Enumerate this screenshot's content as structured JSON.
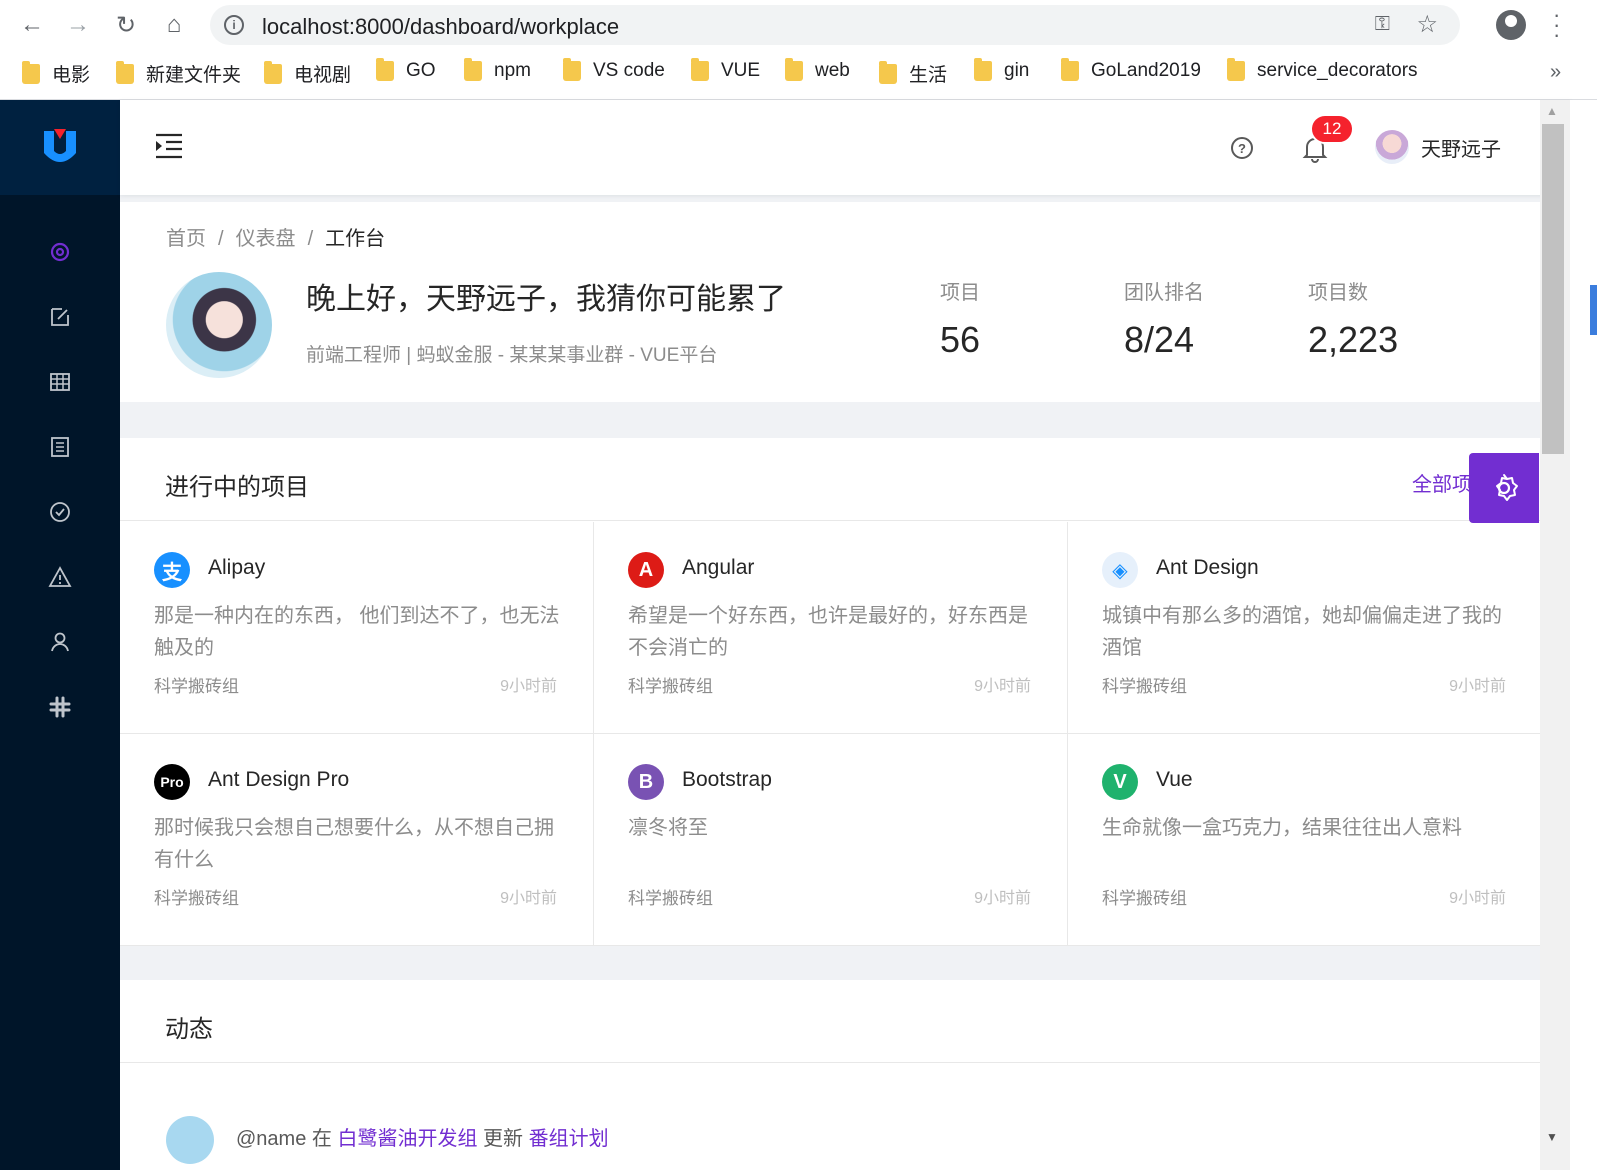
{
  "browser": {
    "url": "localhost:8000/dashboard/workplace",
    "bookmarks": [
      "电影",
      "新建文件夹",
      "电视剧",
      "GO",
      "npm",
      "VS code",
      "VUE",
      "web",
      "生活",
      "gin",
      "GoLand2019",
      "service_decorators"
    ],
    "more": "»"
  },
  "header": {
    "notification_count": "12",
    "username": "天野远子"
  },
  "breadcrumb": [
    "首页",
    "仪表盘",
    "工作台"
  ],
  "breadcrumb_sep": "/",
  "profile": {
    "greeting": "晚上好，天野远子，我猜你可能累了",
    "subtitle": "前端工程师 | 蚂蚁金服 - 某某某事业群 - VUE平台",
    "stats": [
      {
        "label": "项目",
        "value": "56"
      },
      {
        "label": "团队排名",
        "value": "8/24"
      },
      {
        "label": "项目数",
        "value": "2,223"
      }
    ]
  },
  "projects": {
    "title": "进行中的项目",
    "all_link": "全部项",
    "items": [
      {
        "name": "Alipay",
        "desc": "那是一种内在的东西， 他们到达不了，也无法触及的",
        "group": "科学搬砖组",
        "time": "9小时前",
        "icon": "alipay-icon",
        "color": "#1890ff",
        "glyph": "支"
      },
      {
        "name": "Angular",
        "desc": "希望是一个好东西，也许是最好的，好东西是不会消亡的",
        "group": "科学搬砖组",
        "time": "9小时前",
        "icon": "angular-icon",
        "color": "#dd1b16",
        "glyph": "A"
      },
      {
        "name": "Ant Design",
        "desc": "城镇中有那么多的酒馆，她却偏偏走进了我的酒馆",
        "group": "科学搬砖组",
        "time": "9小时前",
        "icon": "ant-design-icon",
        "color": "#e6f0fb",
        "glyph": "◈"
      },
      {
        "name": "Ant Design Pro",
        "desc": "那时候我只会想自己想要什么，从不想自己拥有什么",
        "group": "科学搬砖组",
        "time": "9小时前",
        "icon": "ant-design-pro-icon",
        "color": "#000000",
        "glyph": "Pro"
      },
      {
        "name": "Bootstrap",
        "desc": "凛冬将至",
        "group": "科学搬砖组",
        "time": "9小时前",
        "icon": "bootstrap-icon",
        "color": "#7952b3",
        "glyph": "B"
      },
      {
        "name": "Vue",
        "desc": "生命就像一盒巧克力，结果往往出人意料",
        "group": "科学搬砖组",
        "time": "9小时前",
        "icon": "vue-icon",
        "color": "#1fb26d",
        "glyph": "V"
      }
    ]
  },
  "activity": {
    "title": "动态",
    "items": [
      {
        "user": "@name",
        "at": "在",
        "group": "白鹭酱油开发组",
        "action": "更新",
        "target": "番组计划"
      }
    ]
  },
  "colors": {
    "primary": "#722ed1",
    "sider": "#001529",
    "logo_bg": "#002140",
    "badge": "#f5222d"
  }
}
